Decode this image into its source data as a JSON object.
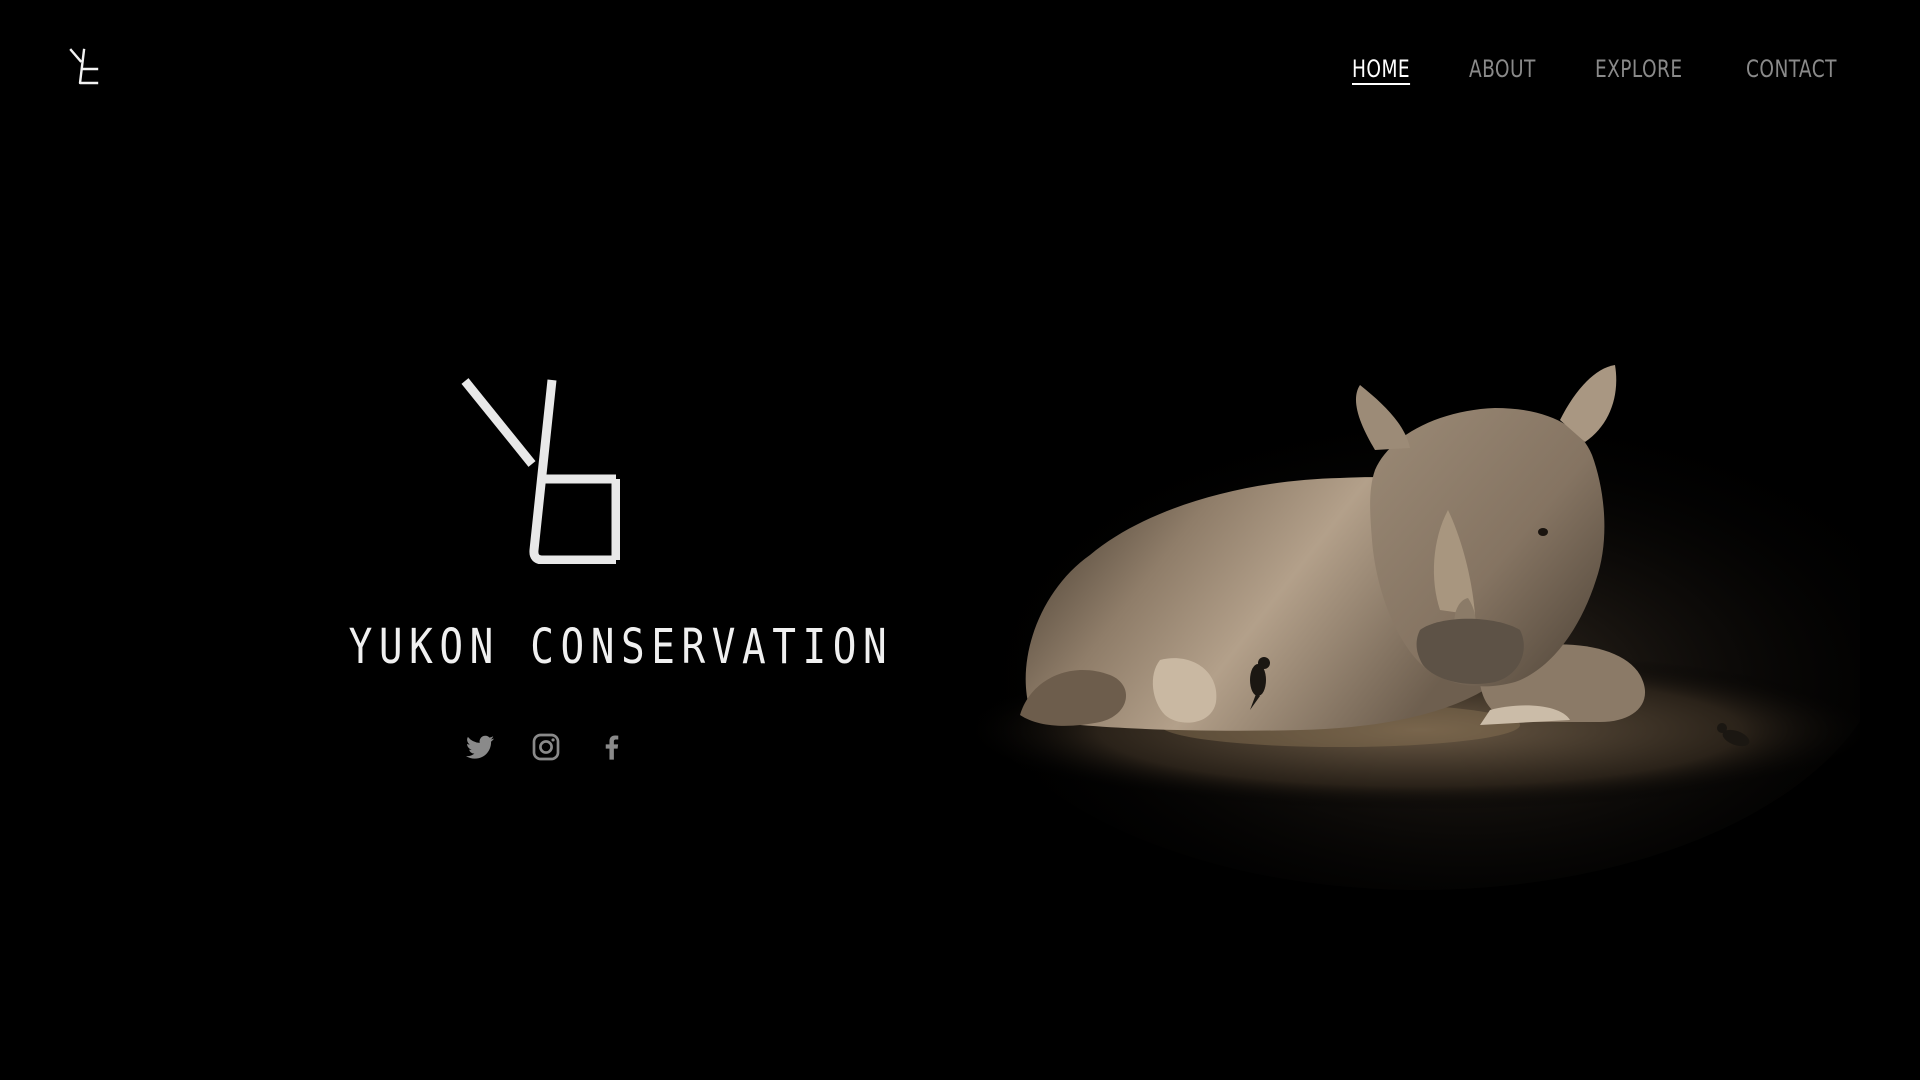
{
  "header": {
    "logo_icon": "yc-monogram-icon",
    "nav": [
      {
        "label": "HOME",
        "active": true
      },
      {
        "label": "ABOUT",
        "active": false
      },
      {
        "label": "EXPLORE",
        "active": false
      },
      {
        "label": "CONTACT",
        "active": false
      }
    ]
  },
  "hero": {
    "logo_icon": "yc-monogram-icon",
    "brand_name": "YUKON CONSERVATION",
    "social": [
      "twitter-icon",
      "instagram-icon",
      "facebook-icon"
    ],
    "image_subject": "rhino-illustration"
  },
  "colors": {
    "background": "#000000",
    "nav_active": "#ffffff",
    "nav_inactive": "#8a8a8a",
    "brand_text": "#f0f0f0",
    "social_icons": "#8a8a8a"
  }
}
